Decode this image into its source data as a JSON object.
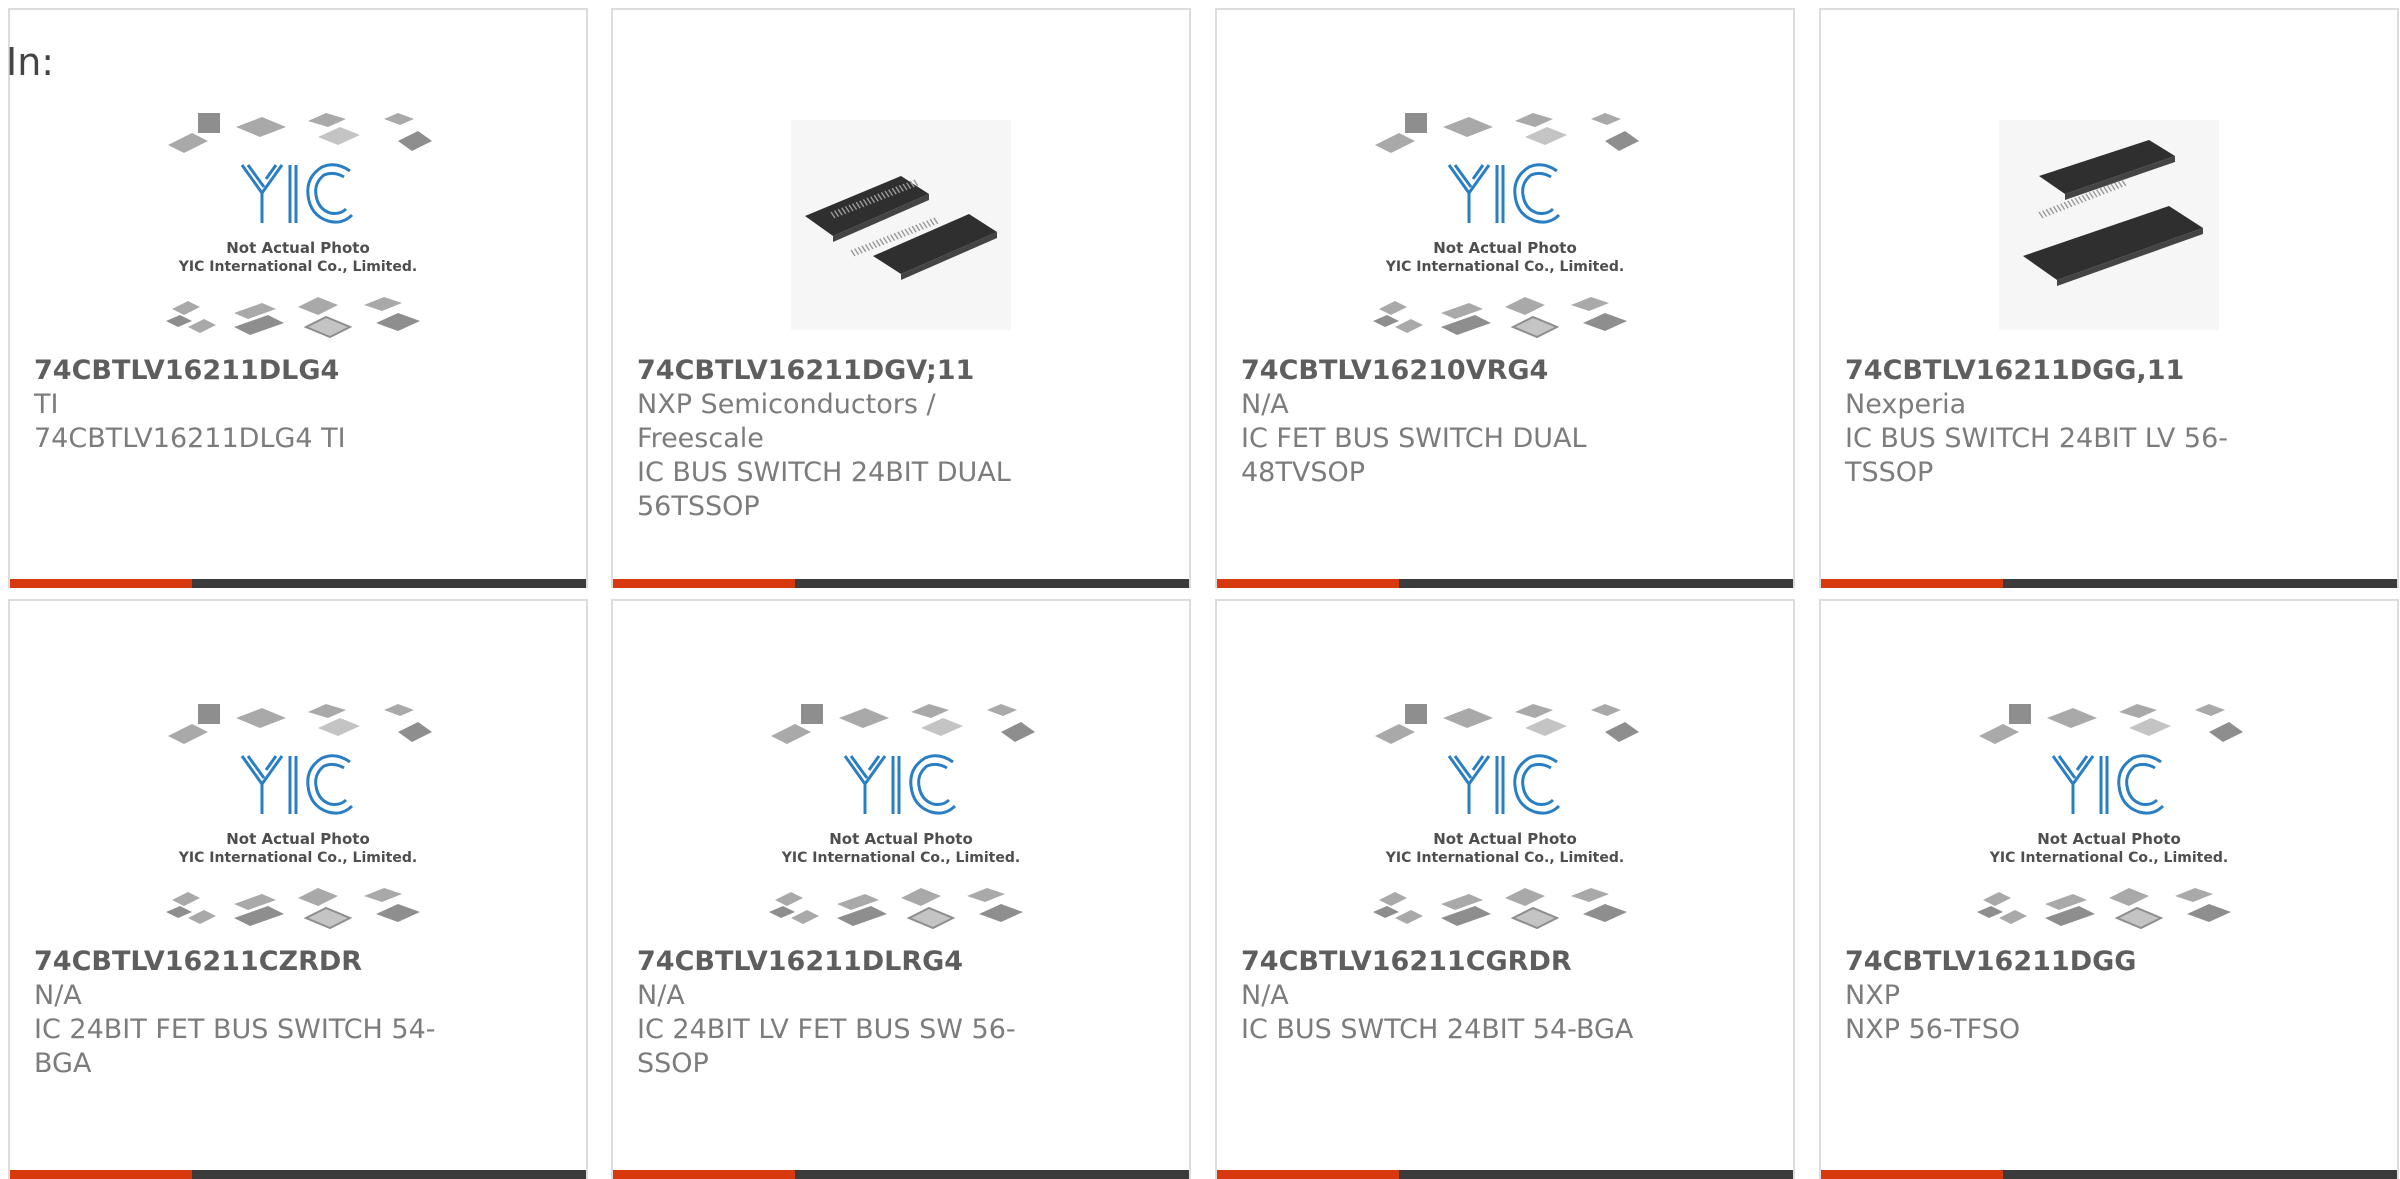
{
  "filter_label": "In:",
  "placeholder_image": {
    "logo_text": "YIC",
    "line1": "Not Actual Photo",
    "line2": "YIC International Co., Limited."
  },
  "colors": {
    "accent": "#d8380e",
    "bar_dark": "#3b3b3b",
    "logo_blue": "#2a7ec4",
    "chip_gray": "#a8a8a8"
  },
  "products": [
    {
      "part_number": "74CBTLV16211DLG4",
      "manufacturer": "TI",
      "description": "74CBTLV16211DLG4 TI",
      "image": "placeholder"
    },
    {
      "part_number": "74CBTLV16211DGV;11",
      "manufacturer": "NXP Semiconductors / Freescale",
      "description": "IC BUS SWITCH 24BIT DUAL 56TSSOP",
      "image": "chip-photo"
    },
    {
      "part_number": "74CBTLV16210VRG4",
      "manufacturer": "N/A",
      "description": "IC FET BUS SWITCH DUAL 48TVSOP",
      "image": "placeholder"
    },
    {
      "part_number": "74CBTLV16211DGG,11",
      "manufacturer": "Nexperia",
      "description": "IC BUS SWITCH 24BIT LV 56-TSSOP",
      "image": "chip-photo"
    },
    {
      "part_number": "74CBTLV16211CZRDR",
      "manufacturer": "N/A",
      "description": "IC 24BIT FET BUS SWITCH 54-BGA",
      "image": "placeholder"
    },
    {
      "part_number": "74CBTLV16211DLRG4",
      "manufacturer": "N/A",
      "description": "IC 24BIT LV FET BUS SW 56-SSOP",
      "image": "placeholder"
    },
    {
      "part_number": "74CBTLV16211CGRDR",
      "manufacturer": "N/A",
      "description": "IC BUS SWTCH 24BIT 54-BGA",
      "image": "placeholder"
    },
    {
      "part_number": "74CBTLV16211DGG",
      "manufacturer": "NXP",
      "description": "NXP 56-TFSO",
      "image": "placeholder"
    }
  ]
}
